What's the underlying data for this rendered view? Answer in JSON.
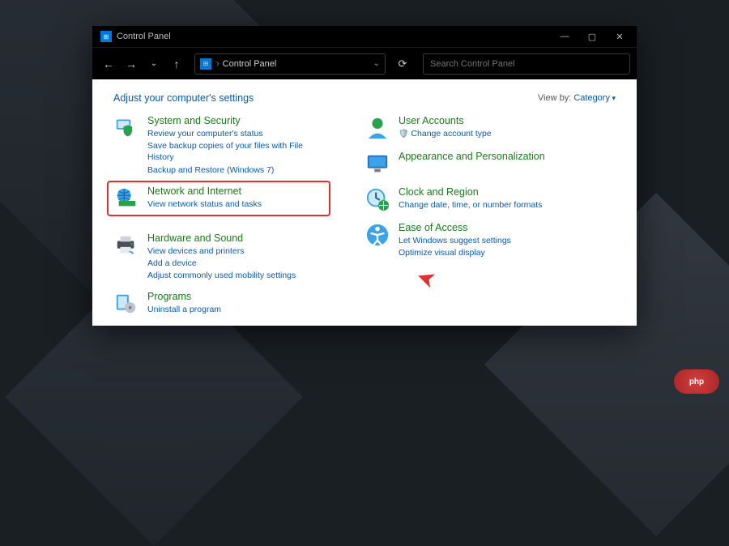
{
  "window": {
    "title": "Control Panel"
  },
  "address": {
    "path": "Control Panel"
  },
  "search": {
    "placeholder": "Search Control Panel"
  },
  "header": {
    "adjust": "Adjust your computer's settings",
    "viewby_label": "View by:",
    "viewby_value": "Category"
  },
  "categories": {
    "system": {
      "title": "System and Security",
      "links": [
        "Review your computer's status",
        "Save backup copies of your files with File History",
        "Backup and Restore (Windows 7)"
      ]
    },
    "network": {
      "title": "Network and Internet",
      "links": [
        "View network status and tasks"
      ]
    },
    "hardware": {
      "title": "Hardware and Sound",
      "links": [
        "View devices and printers",
        "Add a device",
        "Adjust commonly used mobility settings"
      ]
    },
    "programs": {
      "title": "Programs",
      "links": [
        "Uninstall a program"
      ]
    },
    "users": {
      "title": "User Accounts",
      "links": [
        "Change account type"
      ]
    },
    "appearance": {
      "title": "Appearance and Personalization",
      "links": []
    },
    "clock": {
      "title": "Clock and Region",
      "links": [
        "Change date, time, or number formats"
      ]
    },
    "ease": {
      "title": "Ease of Access",
      "links": [
        "Let Windows suggest settings",
        "Optimize visual display"
      ]
    }
  },
  "watermark": "php"
}
